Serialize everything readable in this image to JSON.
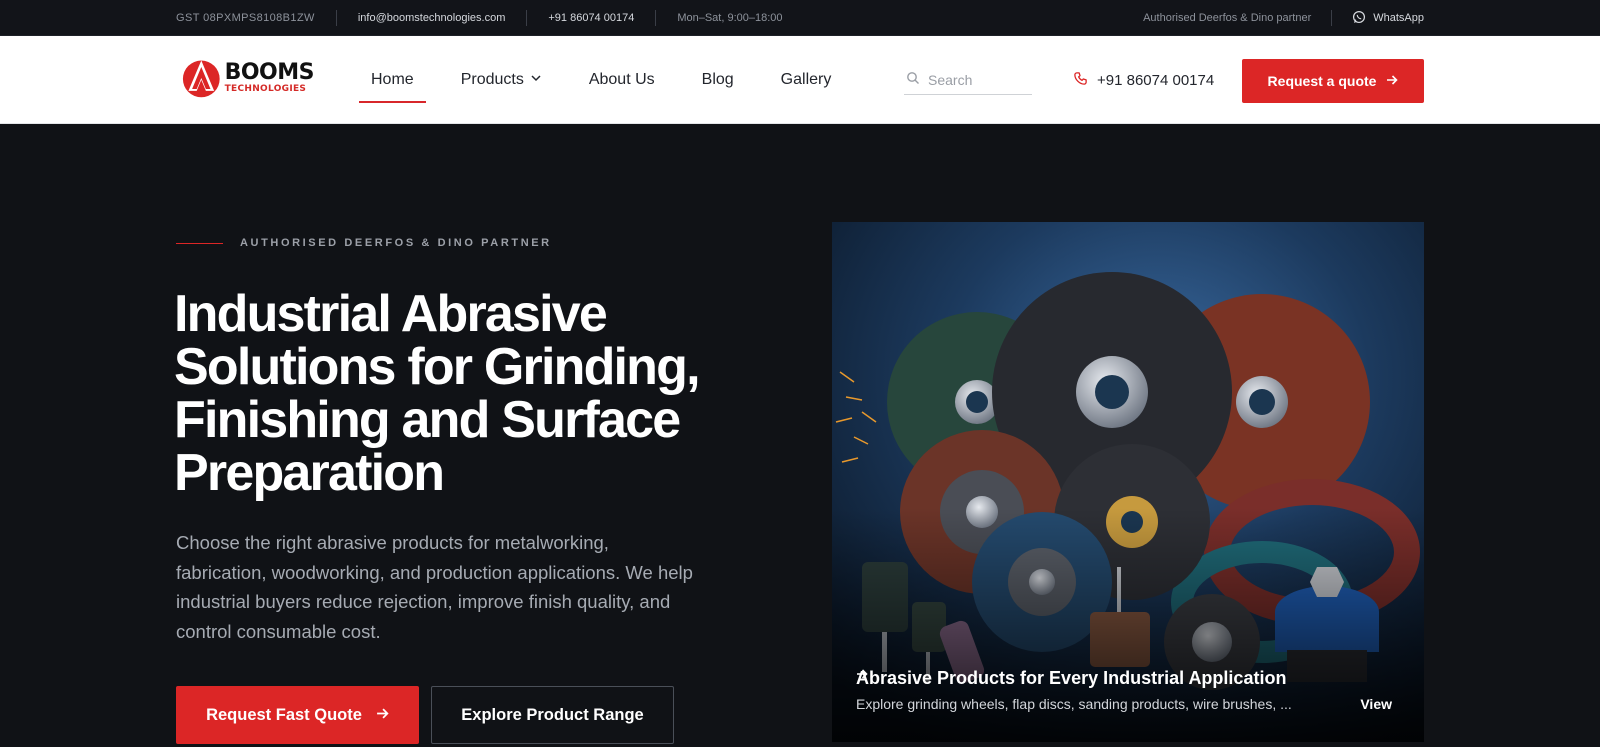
{
  "topbar": {
    "gst": "GST 08PXMPS8108B1ZW",
    "email": "info@boomstechnologies.com",
    "phone": "+91 86074 00174",
    "hours": "Mon–Sat, 9:00–18:00",
    "partner": "Authorised Deerfos & Dino partner",
    "whatsapp": "WhatsApp"
  },
  "brand": {
    "name": "BOOMS",
    "tagline": "TECHNOLOGIES",
    "accent_color": "#dc2626"
  },
  "nav": {
    "items": [
      {
        "label": "Home",
        "active": true
      },
      {
        "label": "Products",
        "has_dropdown": true
      },
      {
        "label": "About Us"
      },
      {
        "label": "Blog"
      },
      {
        "label": "Gallery"
      }
    ]
  },
  "search": {
    "placeholder": "Search",
    "value": ""
  },
  "header": {
    "phone": "+91 86074 00174",
    "cta": "Request a quote"
  },
  "hero": {
    "eyebrow": "AUTHORISED DEERFOS & DINO PARTNER",
    "headline": "Industrial Abrasive Solutions for Grinding, Finishing and Surface Preparation",
    "subtext": "Choose the right abrasive products for metalworking, fabrication, woodworking, and production applications. We help industrial buyers reduce rejection, improve finish quality, and control consumable cost.",
    "primary_button": "Request Fast Quote",
    "secondary_button": "Explore Product Range"
  },
  "card": {
    "title": "Abrasive Products for Every Industrial Application",
    "description": "Explore grinding wheels, flap discs, sanding products, wire brushes, ...",
    "link": "View"
  }
}
